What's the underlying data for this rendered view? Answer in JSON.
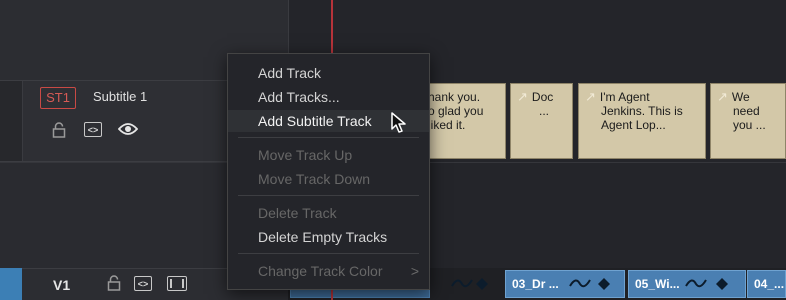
{
  "subtitle_track": {
    "badge": "ST1",
    "name": "Subtitle 1",
    "icons": [
      "lock-icon",
      "code-icon",
      "eye-icon"
    ]
  },
  "video_track": {
    "label": "V1",
    "icons": [
      "lock-icon",
      "code-icon",
      "film-icon"
    ]
  },
  "subtitle_clips": [
    {
      "lines": [
        "hank you.",
        "o glad you",
        "liked it."
      ]
    },
    {
      "lines": [
        "Doc",
        "..."
      ]
    },
    {
      "lines": [
        "I'm Agent",
        "Jenkins. This is",
        "Agent Lop..."
      ]
    },
    {
      "lines": [
        "We",
        "need",
        "you ..."
      ]
    }
  ],
  "video_clips": [
    {
      "label": "_"
    },
    {
      "label": "03_Dr ..."
    },
    {
      "label": "05_Wi..."
    },
    {
      "label": "04_..."
    }
  ],
  "context_menu": {
    "items": [
      {
        "label": "Add Track",
        "enabled": true
      },
      {
        "label": "Add Tracks...",
        "enabled": true
      },
      {
        "label": "Add Subtitle Track",
        "enabled": true,
        "highlighted": true
      },
      {
        "label": "Move Track Up",
        "enabled": false
      },
      {
        "label": "Move Track Down",
        "enabled": false
      },
      {
        "label": "Delete Track",
        "enabled": false
      },
      {
        "label": "Delete Empty Tracks",
        "enabled": true
      },
      {
        "label": "Change Track Color",
        "enabled": false,
        "submenu_glyph": ">"
      }
    ]
  },
  "colors": {
    "playhead": "#b6333a",
    "subtitle_clip": "#d3c8a8",
    "video_clip": "#4a7fb2",
    "st_badge": "#c94a45"
  }
}
